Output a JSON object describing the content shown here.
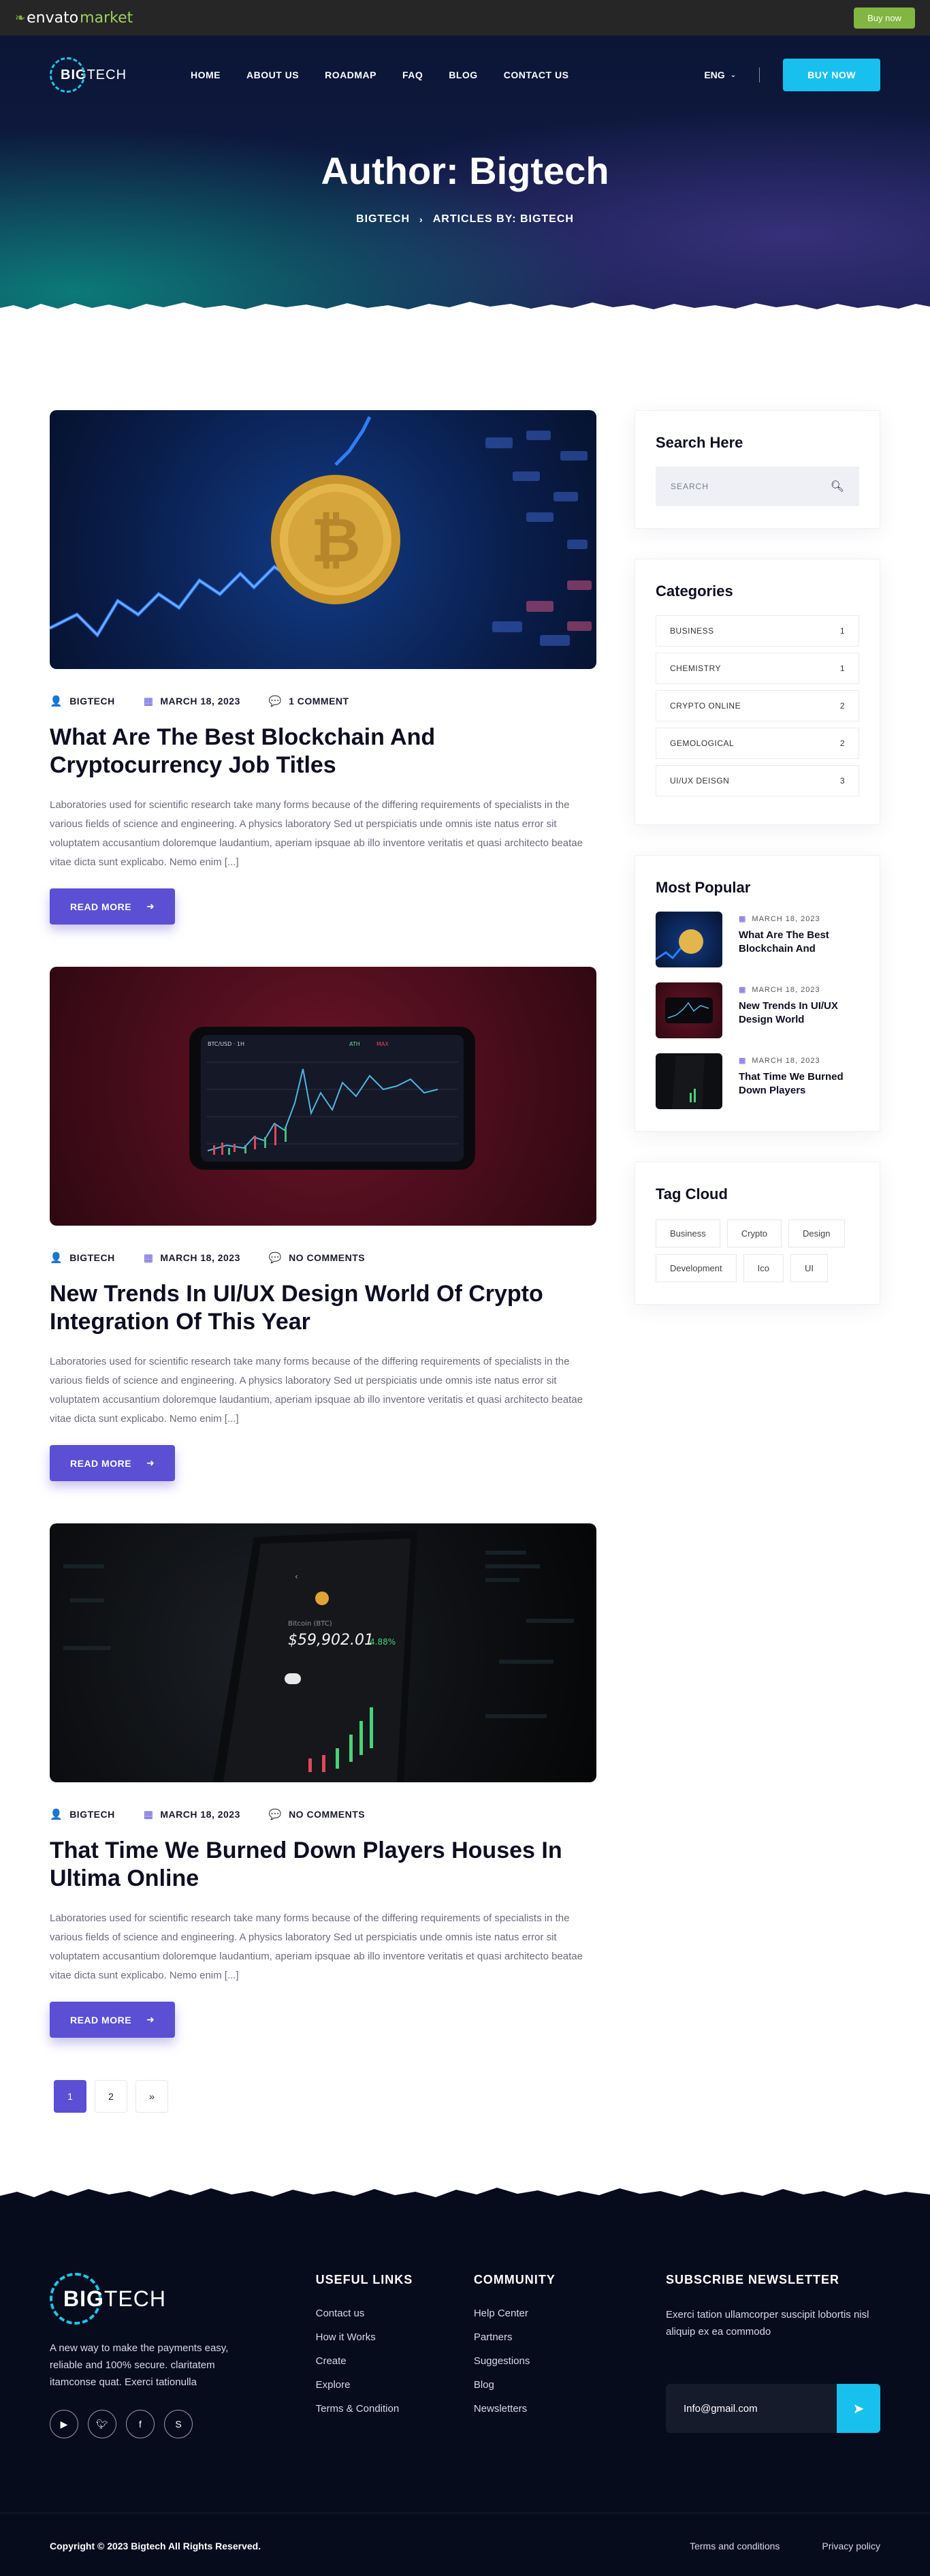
{
  "envato": {
    "logo_prefix": "envato",
    "logo_suffix": "market",
    "buy_label": "Buy now"
  },
  "header": {
    "logo_big": "BIG",
    "logo_tech": "TECH",
    "menu": [
      "HOME",
      "ABOUT US",
      "ROADMAP",
      "FAQ",
      "BLOG",
      "CONTACT US"
    ],
    "language": "ENG",
    "buy_button": "BUY NOW"
  },
  "hero": {
    "title": "Author: Bigtech",
    "breadcrumb": [
      "BIGTECH",
      "ARTICLES BY: BIGTECH"
    ]
  },
  "posts": [
    {
      "author": "BIGTECH",
      "date": "MARCH 18, 2023",
      "comments": "1 COMMENT",
      "title": "What Are The Best Blockchain And Cryptocurrency Job Titles",
      "excerpt": "Laboratories used for scientific research take many forms because of the differing requirements of specialists in the various fields of science and engineering. A physics laboratory Sed ut perspiciatis unde omnis iste natus error sit voluptatem accusantium doloremque laudantium, aperiam ipsquae ab illo inventore veritatis et quasi architecto beatae vitae dicta sunt explicabo. Nemo enim [...]",
      "read_more": "READ MORE"
    },
    {
      "author": "BIGTECH",
      "date": "MARCH 18, 2023",
      "comments": "NO COMMENTS",
      "title": "New Trends In UI/UX Design World Of Crypto Integration Of This Year",
      "excerpt": "Laboratories used for scientific research take many forms because of the differing requirements of specialists in the various fields of science and engineering. A physics laboratory Sed ut perspiciatis unde omnis iste natus error sit voluptatem accusantium doloremque laudantium, aperiam ipsquae ab illo inventore veritatis et quasi architecto beatae vitae dicta sunt explicabo. Nemo enim [...]",
      "read_more": "READ MORE"
    },
    {
      "author": "BIGTECH",
      "date": "MARCH 18, 2023",
      "comments": "NO COMMENTS",
      "title": "That Time We Burned Down Players Houses In Ultima Online",
      "excerpt": "Laboratories used for scientific research take many forms because of the differing requirements of specialists in the various fields of science and engineering. A physics laboratory Sed ut perspiciatis unde omnis iste natus error sit voluptatem accusantium doloremque laudantium, aperiam ipsquae ab illo inventore veritatis et quasi architecto beatae vitae dicta sunt explicabo. Nemo enim [...]",
      "read_more": "READ MORE"
    }
  ],
  "post_images": {
    "post1_phone_price": "$59,902.01",
    "post1_phone_change": "4.88%",
    "post1_phone_label": "Bitcoin (BTC)"
  },
  "pagination": [
    "1",
    "2",
    "»"
  ],
  "sidebar": {
    "search_title": "Search Here",
    "search_placeholder": "SEARCH",
    "categories_title": "Categories",
    "categories": [
      {
        "name": "BUSINESS",
        "count": "1"
      },
      {
        "name": "CHEMISTRY",
        "count": "1"
      },
      {
        "name": "CRYPTO ONLINE",
        "count": "2"
      },
      {
        "name": "GEMOLOGICAL",
        "count": "2"
      },
      {
        "name": "UI/UX DEISGN",
        "count": "3"
      }
    ],
    "popular_title": "Most Popular",
    "popular": [
      {
        "date": "MARCH 18, 2023",
        "title": "What Are The Best Blockchain And"
      },
      {
        "date": "MARCH 18, 2023",
        "title": "New Trends In UI/UX Design World"
      },
      {
        "date": "MARCH 18, 2023",
        "title": "That Time We Burned Down Players"
      }
    ],
    "tags_title": "Tag Cloud",
    "tags": [
      "Business",
      "Crypto",
      "Design",
      "Development",
      "Ico",
      "UI"
    ]
  },
  "footer": {
    "logo_big": "BIG",
    "logo_tech": "TECH",
    "about": "A new way to make the payments easy, reliable and 100% secure. claritatem itamconse quat. Exerci tationulla",
    "useful_title": "USEFUL LINKS",
    "useful_links": [
      "Contact us",
      "How it Works",
      "Create",
      "Explore",
      "Terms & Condition"
    ],
    "community_title": "COMMUNITY",
    "community_links": [
      "Help Center",
      "Partners",
      "Suggestions",
      "Blog",
      "Newsletters"
    ],
    "newsletter_title": "SUBSCRIBE NEWSLETTER",
    "newsletter_text": "Exerci tation ullamcorper suscipit lobortis nisl aliquip ex ea commodo",
    "newsletter_value": "Info@gmail.com",
    "copyright": "Copyright © 2023 Bigtech All Rights Reserved.",
    "bottom_links": [
      "Terms and conditions",
      "Privacy policy"
    ]
  },
  "colors": {
    "accent": "#5b4fd4",
    "cyan": "#18c0ee",
    "envato_green": "#82b541",
    "footer_bg": "#070c1d"
  },
  "icons": [
    "user-icon",
    "calendar-icon",
    "comment-icon",
    "arrow-right-icon",
    "search-icon",
    "chevron-down-icon",
    "send-icon",
    "youtube-icon",
    "twitter-icon",
    "facebook-icon",
    "skype-icon"
  ]
}
